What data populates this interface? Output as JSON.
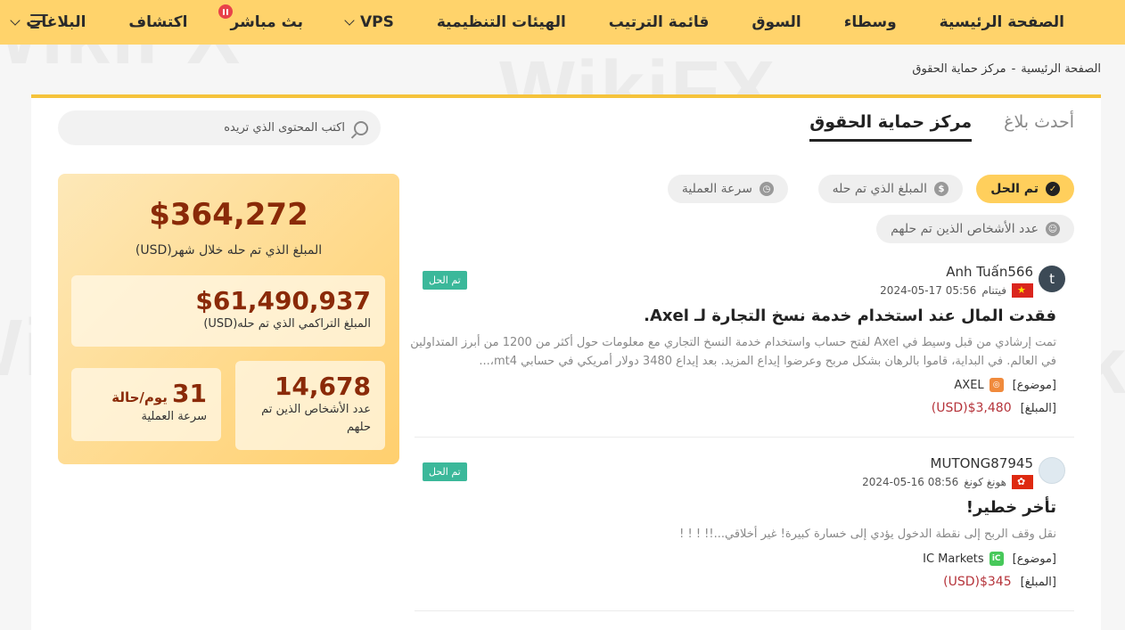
{
  "nav": {
    "items": [
      {
        "label": "الصفحة الرئيسية"
      },
      {
        "label": "وسطاء"
      },
      {
        "label": "السوق"
      },
      {
        "label": "قائمة الترتيب"
      },
      {
        "label": "الهيئات التنظيمية"
      },
      {
        "label": "VPS",
        "dropdown": true
      },
      {
        "label": "بث مباشر",
        "live": true
      },
      {
        "label": "اكتشاف"
      },
      {
        "label": "البلاغات",
        "dropdown": true
      }
    ],
    "menu_icon": "hamburger-menu-icon"
  },
  "breadcrumb": {
    "home": "الصفحة الرئيسية",
    "separator": "-",
    "current": "مركز حماية الحقوق"
  },
  "search": {
    "placeholder": "اكتب المحتوى الذي تريده"
  },
  "stats": {
    "monthly_amount": "$364,272",
    "monthly_label": "المبلغ الذي تم حله خلال شهر(USD)",
    "cumulative_amount": "$61,490,937",
    "cumulative_label": "المبلغ التراكمي الذي تم حله(USD)",
    "people_count": "14,678",
    "people_label": "عدد الأشخاص الذين تم حلهم",
    "speed_value": "31",
    "speed_unit": "يوم/حالة",
    "speed_label": "سرعة العملية"
  },
  "tabs": [
    {
      "label": "أحدث بلاغ",
      "active": false
    },
    {
      "label": "مركز حماية الحقوق",
      "active": true
    }
  ],
  "filters": [
    {
      "label": "تم الحل",
      "icon": "check-circle-icon",
      "active": true
    },
    {
      "label": "المبلغ الذي تم حله",
      "icon": "dollar-circle-icon",
      "active": false
    },
    {
      "label": "سرعة العملية",
      "icon": "clock-icon",
      "active": false
    },
    {
      "label": "عدد الأشخاص الذين تم حلهم",
      "icon": "people-icon",
      "active": false
    }
  ],
  "complaints": [
    {
      "user": "Anh Tuấn566",
      "avatar_letter": "t",
      "country": "فيتنام",
      "date": "2024-05-17 05:56",
      "status": "تم الحل",
      "title": "فقدت المال عند استخدام خدمة نسخ التجارة لـ Axel.",
      "desc_line1": "تمت إرشادي من قبل وسيط في Axel لفتح حساب واستخدام خدمة النسخ التجاري مع معلومات حول أكثر من 1200 من أبرز المتداولين في العالم. في البداية، قاموا بالرهان بشكل مربح وعرضوا إيداع المزيد. بعد إيداع 3480 دولار أمريكي في حسابي mt4،...",
      "topic_label": "[موضوع]",
      "broker": "AXEL",
      "amount_label": "[المبلغ]",
      "amount": "(USD)$3,480"
    },
    {
      "user": "MUTONG87945",
      "avatar_letter": "",
      "country": "هونغ كونغ",
      "date": "2024-05-16 08:56",
      "status": "تم الحل",
      "title": "تأخر خطير!",
      "desc_line1": "نقل وقف الربح إلى نقطة الدخول يؤدي إلى خسارة كبيرة! غير أخلاقي...!! ! ! !",
      "topic_label": "[موضوع]",
      "broker": "IC Markets",
      "amount_label": "[المبلغ]",
      "amount": "(USD)$345"
    }
  ],
  "watermark": "WikiFX",
  "colors": {
    "nav_bg": "#ffd36b",
    "accent": "#f5c33b",
    "amount_red": "#b5333a",
    "resolved_green": "#3bb89a",
    "stat_brown": "#8a2a08"
  }
}
